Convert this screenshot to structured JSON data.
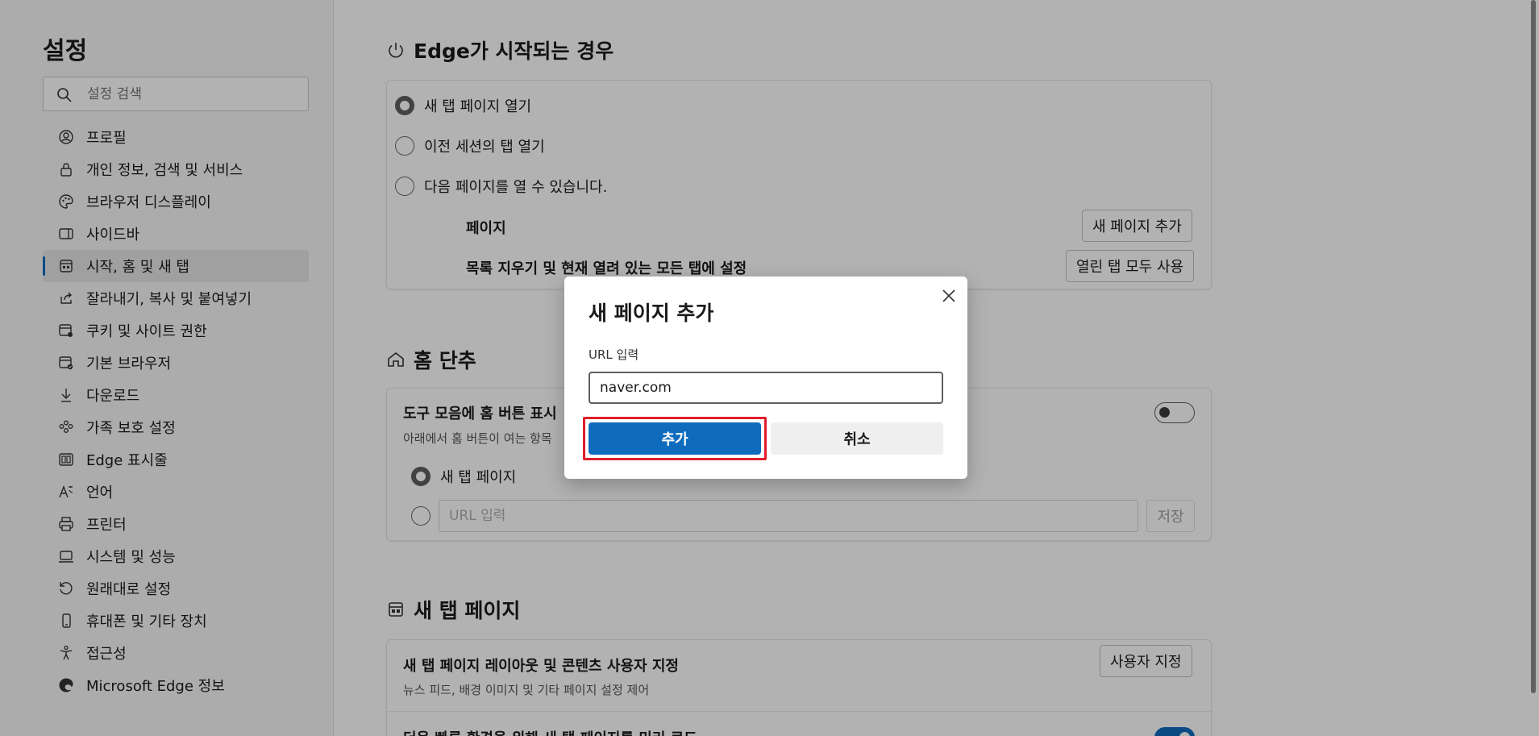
{
  "sidebar": {
    "title": "설정",
    "search_placeholder": "설정 검색",
    "items": [
      {
        "label": "프로필",
        "icon": "profile-icon"
      },
      {
        "label": "개인 정보, 검색 및 서비스",
        "icon": "lock-icon"
      },
      {
        "label": "브라우저 디스플레이",
        "icon": "palette-icon"
      },
      {
        "label": "사이드바",
        "icon": "sidebar-icon"
      },
      {
        "label": "시작, 홈 및 새 탭",
        "icon": "start-home-icon",
        "active": true
      },
      {
        "label": "잘라내기, 복사 및 붙여넣기",
        "icon": "share-icon"
      },
      {
        "label": "쿠키 및 사이트 권한",
        "icon": "cookie-icon"
      },
      {
        "label": "기본 브라우저",
        "icon": "browser-icon"
      },
      {
        "label": "다운로드",
        "icon": "download-icon"
      },
      {
        "label": "가족 보호 설정",
        "icon": "family-icon"
      },
      {
        "label": "Edge 표시줄",
        "icon": "edge-bar-icon"
      },
      {
        "label": "언어",
        "icon": "language-icon"
      },
      {
        "label": "프린터",
        "icon": "printer-icon"
      },
      {
        "label": "시스템 및 성능",
        "icon": "laptop-icon"
      },
      {
        "label": "원래대로 설정",
        "icon": "reset-icon"
      },
      {
        "label": "휴대폰 및 기타 장치",
        "icon": "phone-icon"
      },
      {
        "label": "접근성",
        "icon": "accessibility-icon"
      },
      {
        "label": "Microsoft Edge 정보",
        "icon": "edge-logo-icon"
      }
    ]
  },
  "startup": {
    "title": "Edge가 시작되는 경우",
    "options": [
      "새 탭 페이지 열기",
      "이전 세션의 탭 열기",
      "다음 페이지를 열 수 있습니다."
    ],
    "selected_index": 0,
    "pages_label": "페이지",
    "add_page_button": "새 페이지 추가",
    "clear_label": "목록 지우기 및 현재 열려 있는 모든 탭에 설정",
    "use_open_tabs_button": "열린 탭 모두 사용"
  },
  "home": {
    "title": "홈 단추",
    "toolbar_label": "도구 모음에 홈 버튼 표시",
    "desc": "아래에서 홈 버튼이 여는 항목",
    "option_new_tab": "새 탭 페이지",
    "url_placeholder": "URL 입력",
    "save_button": "저장"
  },
  "newtab": {
    "title": "새 탭 페이지",
    "customize_label": "새 탭 페이지 레이아웃 및 콘텐츠 사용자 지정",
    "customize_desc": "뉴스 피드, 배경 이미지 및 기타 페이지 설정 제어",
    "customize_button": "사용자 지정",
    "preload_label": "더욱 빠른 환경을 위해 새 탭 페이지를 미리 로드"
  },
  "dialog": {
    "title": "새 페이지 추가",
    "field_label": "URL 입력",
    "input_value": "naver.com",
    "add_button": "추가",
    "cancel_button": "취소"
  },
  "colors": {
    "accent": "#0f6cbd",
    "highlight": "#e01e2b"
  }
}
